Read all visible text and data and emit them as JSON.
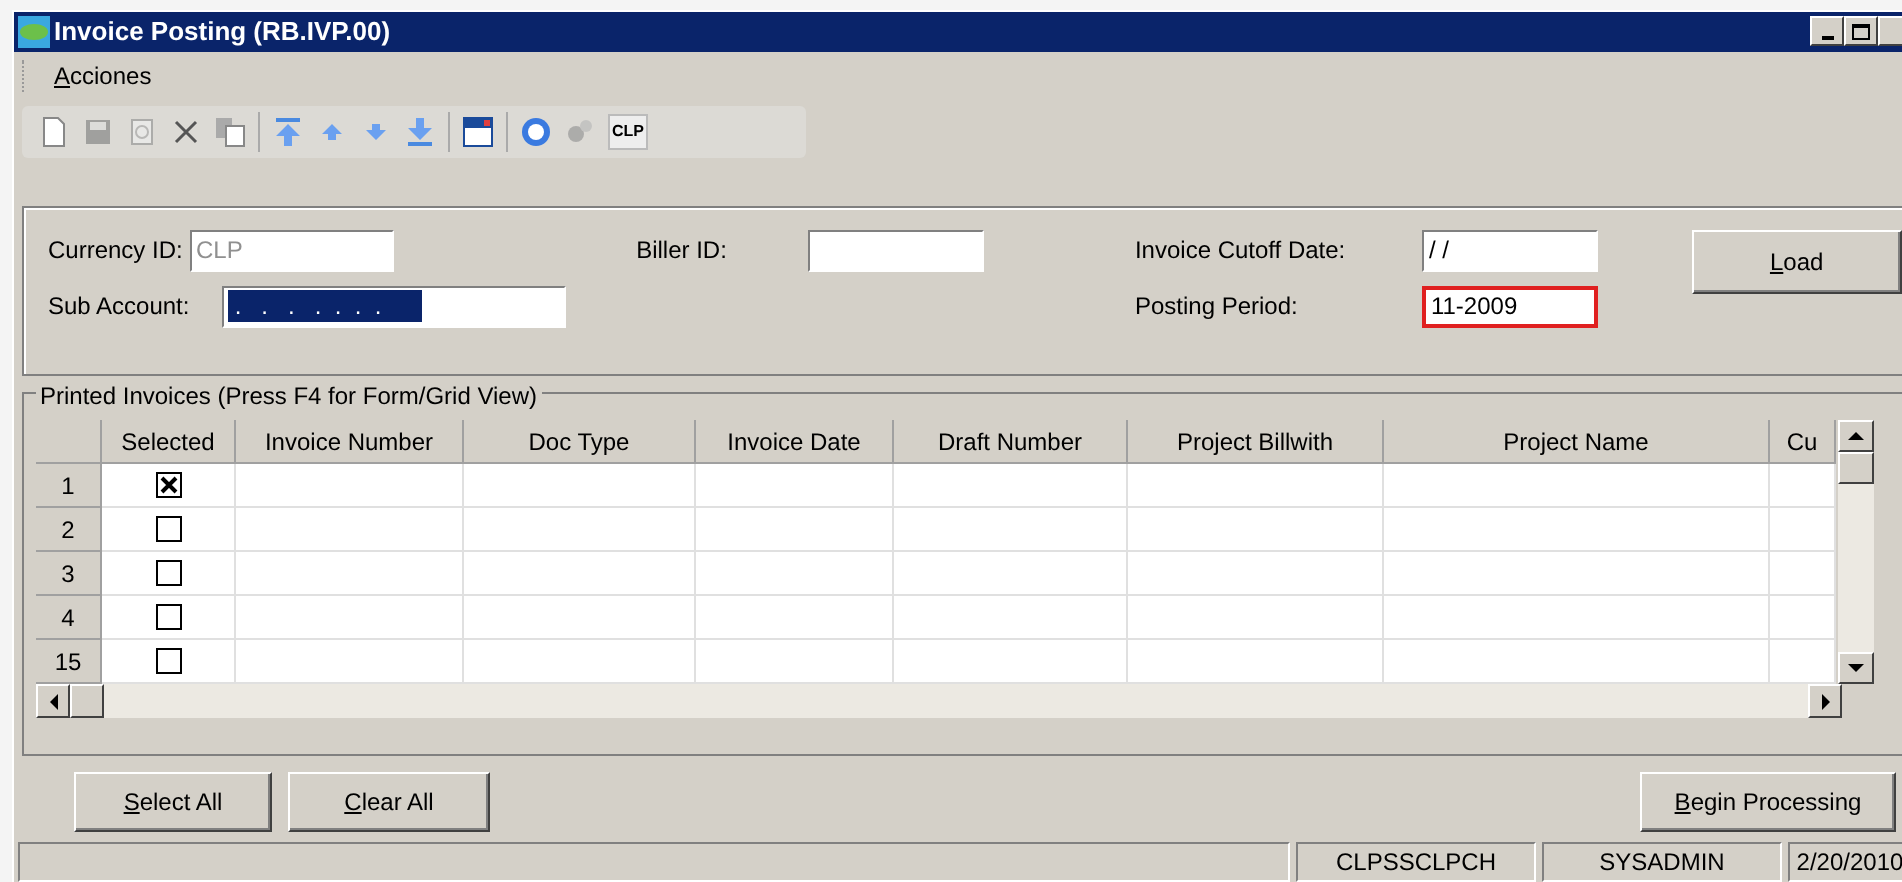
{
  "window": {
    "title": "Invoice Posting (RB.IVP.00)"
  },
  "menu": [
    {
      "label": "Acciones"
    }
  ],
  "toolbar": {
    "clp_button": "CLP"
  },
  "form": {
    "fields": [
      {
        "label": "Currency ID:",
        "value": "CLP",
        "disabled": true
      },
      {
        "label": "Sub Account:",
        "value": " .   .   .   .  .  .  .",
        "selected_text": true
      },
      {
        "label": "Biller ID:"
      },
      {
        "label": "Invoice Cutoff Date:",
        "value": "/ /"
      },
      {
        "label": "Posting Period:",
        "value": "11-2009",
        "error": true
      }
    ],
    "load_button": "Load"
  },
  "grid": {
    "title": "Printed Invoices (Press F4 for Form/Grid View)",
    "columns": [
      "Selected",
      "Invoice Number",
      "Doc Type",
      "Invoice Date",
      "Draft Number",
      "Project Billwith",
      "Project Name",
      "Cu"
    ],
    "rows": [
      {
        "number": "1",
        "selected": true
      },
      {
        "number": "2",
        "selected": false
      },
      {
        "number": "3",
        "selected": false
      },
      {
        "number": "4",
        "selected": false
      },
      {
        "number": "15",
        "selected": false
      }
    ]
  },
  "buttons": {
    "select_all": "Select All",
    "clear_all": "Clear All",
    "begin_processing": "Begin Processing"
  },
  "status_bar": [
    "CLPSSCLPCH",
    "SYSADMIN",
    "2/20/2010"
  ]
}
